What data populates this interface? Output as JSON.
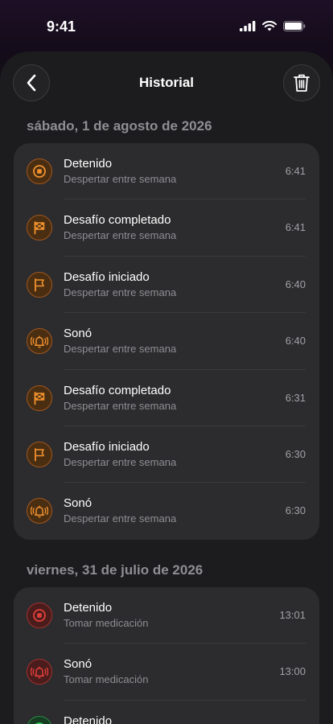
{
  "status_bar": {
    "time": "9:41"
  },
  "header": {
    "title": "Historial"
  },
  "colors": {
    "accent_orange": "#f0912e",
    "accent_red": "#e0403a",
    "accent_green": "#34c759"
  },
  "sections": [
    {
      "date": "sábado, 1 de agosto de 2026",
      "events": [
        {
          "title": "Detenido",
          "subtitle": "Despertar entre semana",
          "time": "6:41",
          "icon": "stop-icon",
          "color": "orange"
        },
        {
          "title": "Desafío completado",
          "subtitle": "Despertar entre semana",
          "time": "6:41",
          "icon": "checkered-flag-icon",
          "color": "orange"
        },
        {
          "title": "Desafío iniciado",
          "subtitle": "Despertar entre semana",
          "time": "6:40",
          "icon": "flag-icon",
          "color": "orange"
        },
        {
          "title": "Sonó",
          "subtitle": "Despertar entre semana",
          "time": "6:40",
          "icon": "bell-ringing-icon",
          "color": "orange"
        },
        {
          "title": "Desafío completado",
          "subtitle": "Despertar entre semana",
          "time": "6:31",
          "icon": "checkered-flag-icon",
          "color": "orange"
        },
        {
          "title": "Desafío iniciado",
          "subtitle": "Despertar entre semana",
          "time": "6:30",
          "icon": "flag-icon",
          "color": "orange"
        },
        {
          "title": "Sonó",
          "subtitle": "Despertar entre semana",
          "time": "6:30",
          "icon": "bell-ringing-icon",
          "color": "orange"
        }
      ]
    },
    {
      "date": "viernes, 31 de julio de 2026",
      "events": [
        {
          "title": "Detenido",
          "subtitle": "Tomar medicación",
          "time": "13:01",
          "icon": "stop-icon",
          "color": "red"
        },
        {
          "title": "Sonó",
          "subtitle": "Tomar medicación",
          "time": "13:00",
          "icon": "bell-ringing-icon",
          "color": "red"
        },
        {
          "title": "Detenido",
          "subtitle": "",
          "time": "",
          "icon": "stop-icon",
          "color": "green"
        }
      ]
    }
  ]
}
